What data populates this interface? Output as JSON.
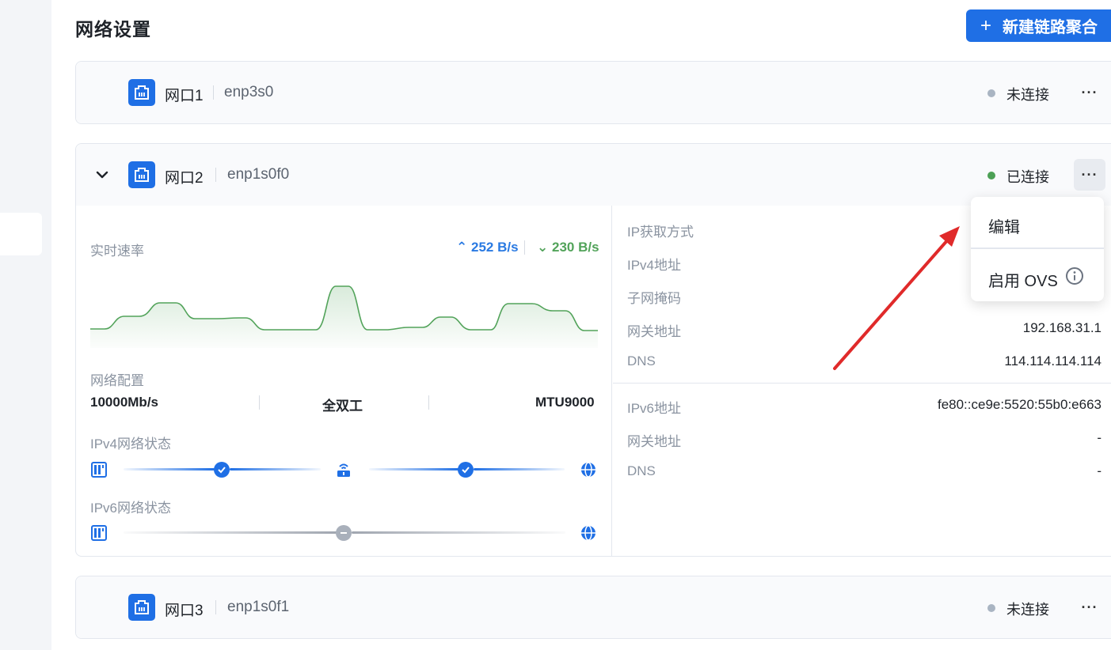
{
  "page": {
    "title": "网络设置",
    "new_bond_button": "新建链路聚合"
  },
  "ports": [
    {
      "name": "网口1",
      "device": "enp3s0",
      "status": "未连接",
      "status_color": "#a9b4c2"
    },
    {
      "name": "网口2",
      "device": "enp1s0f0",
      "status": "已连接",
      "status_color": "#4ca055",
      "details": {
        "realtime_label": "实时速率",
        "upload_speed": "252 B/s",
        "download_speed": "230 B/s",
        "config_label": "网络配置",
        "link_speed": "10000Mb/s",
        "duplex": "全双工",
        "mtu": "MTU9000",
        "ipv4_status_label": "IPv4网络状态",
        "ipv6_status_label": "IPv6网络状态",
        "ipv4_fields": [
          {
            "label": "IP获取方式",
            "value": ""
          },
          {
            "label": "IPv4地址",
            "value": ""
          },
          {
            "label": "子网掩码",
            "value": ""
          },
          {
            "label": "网关地址",
            "value": "192.168.31.1"
          },
          {
            "label": "DNS",
            "value": "114.114.114.114"
          }
        ],
        "ipv6_fields": [
          {
            "label": "IPv6地址",
            "value": "fe80::ce9e:5520:55b0:e663"
          },
          {
            "label": "网关地址",
            "value": "-"
          },
          {
            "label": "DNS",
            "value": "-"
          }
        ]
      }
    },
    {
      "name": "网口3",
      "device": "enp1s0f1",
      "status": "未连接",
      "status_color": "#a9b4c2"
    }
  ],
  "dropdown": {
    "edit": "编辑",
    "enable_ovs": "启用 OVS"
  },
  "colors": {
    "accent": "#1f6fe5",
    "upload": "#2a7ae2",
    "download": "#52a35a",
    "annotation_arrow": "#e02a2a"
  },
  "icons": {
    "port": "ethernet-port-icon",
    "chevron": "chevron-down-icon",
    "more": "more-horizontal-icon",
    "info": "info-circle-icon",
    "device": "server-icon",
    "router": "router-icon",
    "internet": "globe-icon"
  }
}
